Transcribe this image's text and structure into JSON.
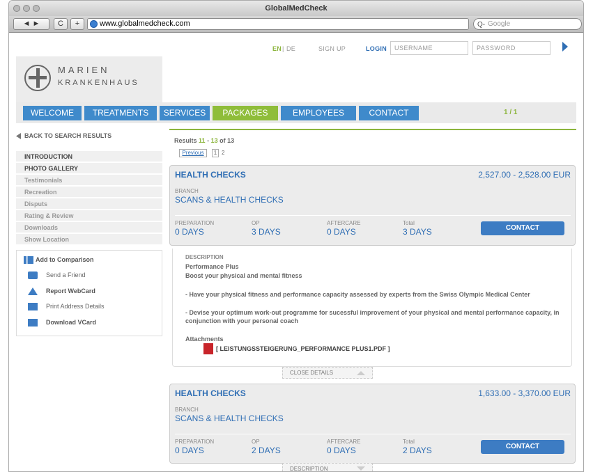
{
  "window": {
    "title": "GlobalMedCheck",
    "url": "www.globalmedcheck.com",
    "search_placeholder": "Google",
    "search_glyph": "Q-"
  },
  "toolbar": {
    "back": "◄ ►",
    "reload": "C",
    "add": "+"
  },
  "topbar": {
    "lang_en": "EN",
    "lang_sep": "|",
    "lang_de": "DE",
    "signup": "SIGN UP",
    "login": "LOGIN",
    "username": "USERNAME",
    "password": "PASSWORD"
  },
  "logo": {
    "line1": "MARIEN",
    "line2": "KRANKENHAUS"
  },
  "nav": [
    "WELCOME",
    "TREATMENTS",
    "SERVICES",
    "PACKAGES",
    "EMPLOYEES",
    "CONTACT"
  ],
  "page_indicator": "1 / 1",
  "sidebar": {
    "back": "BACK TO SEARCH RESULTS",
    "items": [
      "INTRODUCTION",
      "PHOTO GALLERY",
      "Testimonials",
      "Recreation",
      "Disputs",
      "Rating & Review",
      "Downloads",
      "Show Location"
    ],
    "actions": [
      "Add to Comparison",
      "Send a Friend",
      "Report WebCard",
      "Print Address Details",
      "Download VCard"
    ]
  },
  "results": {
    "prefix": "Results",
    "from": "11",
    "dash": "-",
    "to": "13",
    "of": "of 13",
    "prev": "Previous",
    "p1": "1",
    "p2": "2"
  },
  "cards": [
    {
      "title": "HEALTH CHECKS",
      "price": "2,527.00 - 2,528.00 EUR",
      "branch_label": "BRANCH",
      "branch": "SCANS & HEALTH CHECKS",
      "prep_label": "PREPARATION",
      "prep": "0 DAYS",
      "op_label": "OP",
      "op": "3 DAYS",
      "after_label": "AFTERCARE",
      "after": "0 DAYS",
      "total_label": "Total",
      "total": "3 DAYS",
      "button": "CONTACT"
    },
    {
      "title": "HEALTH CHECKS",
      "price": "1,633.00 - 3,370.00 EUR",
      "branch_label": "BRANCH",
      "branch": "SCANS & HEALTH CHECKS",
      "prep_label": "PREPARATION",
      "prep": "0 DAYS",
      "op_label": "OP",
      "op": "2 DAYS",
      "after_label": "AFTERCARE",
      "after": "0 DAYS",
      "total_label": "Total",
      "total": "2 DAYS",
      "button": "CONTACT"
    }
  ],
  "details": {
    "desc_label": "DESCRIPTION",
    "name": "Performance Plus",
    "subtitle": "Boost your physical and mental fitness",
    "bullet1": "- Have your physical fitness and performance capacity assessed by experts from the Swiss Olympic Medical Center",
    "bullet2": "- Devise your optimum work-out programme for sucessful improvement of your physical and mental performance capacity, in conjunction with your personal coach",
    "attach_label": "Attachments",
    "attachment": "[ LEISTUNGSSTEIGERUNG_PERFORMANCE PLUS1.PDF ]",
    "close": "CLOSE DETAILS",
    "desc_tab": "DESCRIPTION"
  },
  "colors": {
    "accent": "#2f6eb4",
    "green": "#8cb53d",
    "nav": "#3f8acb"
  }
}
